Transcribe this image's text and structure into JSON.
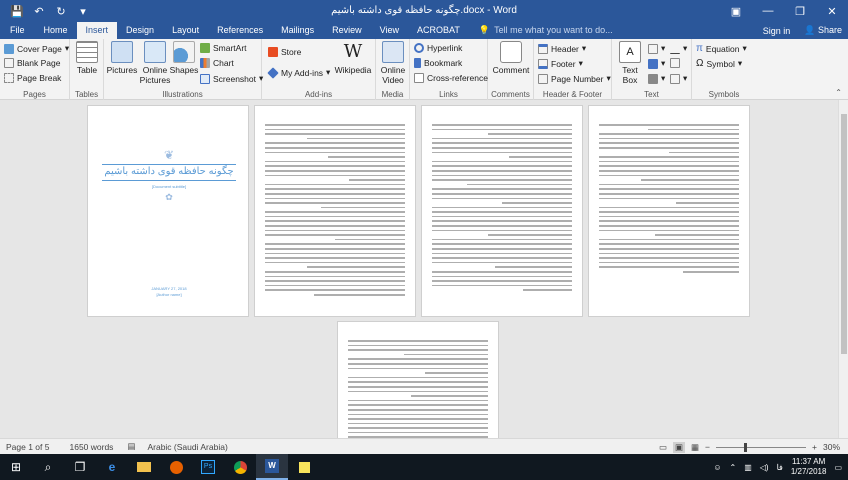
{
  "window": {
    "title": "چگونه حافظه قوی داشته باشیم.docx - Word",
    "controls": [
      "restore-down",
      "minimize",
      "maximize",
      "close"
    ]
  },
  "quick_access": {
    "save": "💾",
    "undo": "↶",
    "redo": "↻",
    "more": "▾"
  },
  "tabs": [
    "File",
    "Home",
    "Insert",
    "Design",
    "Layout",
    "References",
    "Mailings",
    "Review",
    "View",
    "ACROBAT"
  ],
  "active_tab": "Insert",
  "tell_me": {
    "placeholder": "Tell me what you want to do..."
  },
  "account": {
    "sign_in": "Sign in",
    "share": "Share"
  },
  "ribbon": {
    "pages": {
      "label": "Pages",
      "cover": "Cover Page",
      "blank": "Blank Page",
      "break": "Page Break"
    },
    "tables": {
      "label": "Tables",
      "table": "Table"
    },
    "illustrations": {
      "label": "Illustrations",
      "pictures": "Pictures",
      "online_pictures": "Online Pictures",
      "shapes": "Shapes",
      "smartart": "SmartArt",
      "chart": "Chart",
      "screenshot": "Screenshot"
    },
    "addins": {
      "label": "Add-ins",
      "store": "Store",
      "my_addins": "My Add-ins",
      "wikipedia": "Wikipedia"
    },
    "media": {
      "label": "Media",
      "online_video": "Online Video"
    },
    "links": {
      "label": "Links",
      "hyperlink": "Hyperlink",
      "bookmark": "Bookmark",
      "crossref": "Cross-reference"
    },
    "comments": {
      "label": "Comments",
      "comment": "Comment"
    },
    "headerfooter": {
      "label": "Header & Footer",
      "header": "Header",
      "footer": "Footer",
      "page_number": "Page Number"
    },
    "text": {
      "label": "Text",
      "textbox": "Text Box"
    },
    "symbols": {
      "label": "Symbols",
      "equation": "Equation",
      "symbol": "Symbol"
    }
  },
  "cover": {
    "title": "چگونه حافظه قوی داشته باشیم",
    "subtitle": "[Document subtitle]",
    "date": "JANUARY 27, 2018",
    "author": "[Author name]"
  },
  "status": {
    "page": "Page 1 of 5",
    "words": "1650 words",
    "language": "Arabic (Saudi Arabia)",
    "zoom": "30%",
    "zoom_minus": "−",
    "zoom_plus": "+"
  },
  "taskbar": {
    "start": "⊞",
    "search": "⌕",
    "taskview": "❐",
    "time": "11:37 AM",
    "date": "1/27/2018",
    "lang": "فا"
  },
  "colors": {
    "accent": "#2b579a",
    "taskbar": "#101820",
    "cover_title": "#5b9bd5"
  }
}
